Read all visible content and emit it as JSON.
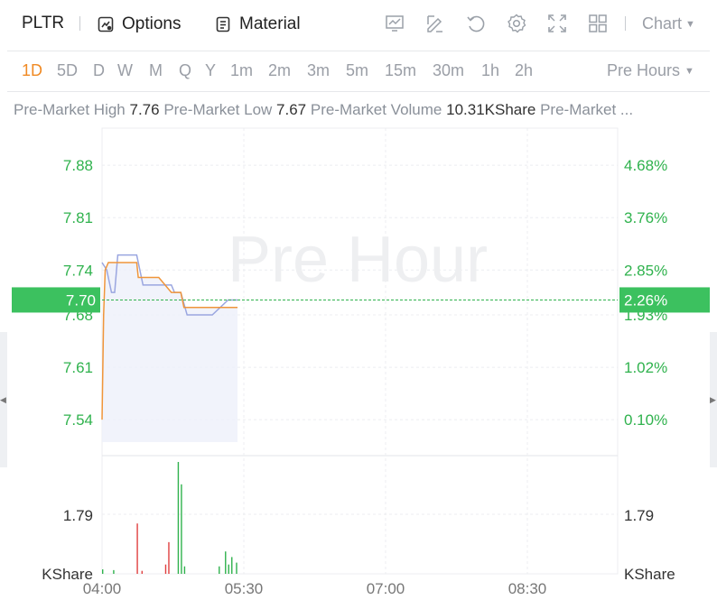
{
  "header": {
    "symbol": "PLTR",
    "options_label": "Options",
    "material_label": "Material",
    "chart_type_label": "Chart",
    "tools": [
      "chart-indicator-icon",
      "draw-icon",
      "reset-icon",
      "settings-icon",
      "fullscreen-icon",
      "layout-grid-icon"
    ]
  },
  "periods": {
    "items": [
      "1D",
      "5D",
      "D",
      "W",
      "M",
      "Q",
      "Y",
      "1m",
      "2m",
      "3m",
      "5m",
      "15m",
      "30m",
      "1h",
      "2h"
    ],
    "active": "1D",
    "hours_select": "Pre Hours"
  },
  "stats": {
    "high_label": "Pre-Market High",
    "high_value": "7.76",
    "low_label": "Pre-Market Low",
    "low_value": "7.67",
    "volume_label": "Pre-Market Volume",
    "volume_value": "10.31KShare",
    "more_label": "Pre-Market ..."
  },
  "chart_data": [
    {
      "type": "line",
      "watermark": "Pre Hour",
      "x_ticks": [
        "04:00",
        "05:30",
        "07:00",
        "08:30"
      ],
      "x_range_minutes": [
        0,
        270
      ],
      "ylim": [
        7.51,
        7.92
      ],
      "y_ticks": [
        "7.88",
        "7.81",
        "7.74",
        "7.68",
        "7.61",
        "7.54"
      ],
      "y_ticks_pct": [
        "4.68%",
        "3.76%",
        "2.85%",
        "1.93%",
        "1.02%",
        "0.10%"
      ],
      "current_price": "7.70",
      "current_pct": "2.26%",
      "colors": {
        "price": "#f0953a",
        "average": "#9aa6e0",
        "up": "#2fb24d",
        "down": "#e04040"
      },
      "series": [
        {
          "x": [
            0,
            1,
            2,
            4,
            7,
            9,
            10,
            13,
            22,
            23,
            27,
            30,
            36,
            44,
            50,
            52,
            54,
            58,
            65,
            72,
            80,
            86
          ],
          "values": [
            7.54,
            7.68,
            7.74,
            7.75,
            7.75,
            7.75,
            7.75,
            7.75,
            7.75,
            7.73,
            7.73,
            7.73,
            7.73,
            7.71,
            7.71,
            7.69,
            7.69,
            7.69,
            7.69,
            7.69,
            7.69,
            7.69
          ]
        },
        {
          "x": [
            0,
            3,
            6,
            8,
            10,
            16,
            22,
            26,
            30,
            36,
            40,
            44,
            46,
            50,
            54,
            60,
            70,
            80,
            86
          ],
          "values": [
            7.75,
            7.74,
            7.71,
            7.71,
            7.76,
            7.76,
            7.76,
            7.72,
            7.72,
            7.72,
            7.72,
            7.72,
            7.71,
            7.71,
            7.68,
            7.68,
            7.68,
            7.7,
            7.7
          ]
        }
      ]
    },
    {
      "type": "bar",
      "label_left": "1.79",
      "label_right": "1.79",
      "unit_left": "KShare",
      "unit_right": "KShare",
      "ylim": [
        0,
        3.0
      ],
      "bars": [
        {
          "x": 0,
          "value": 0.12,
          "dir": "up"
        },
        {
          "x": 7,
          "value": 0.1,
          "dir": "up"
        },
        {
          "x": 22,
          "value": 1.35,
          "dir": "down"
        },
        {
          "x": 25,
          "value": 0.08,
          "dir": "down"
        },
        {
          "x": 40,
          "value": 0.25,
          "dir": "down"
        },
        {
          "x": 42,
          "value": 0.85,
          "dir": "down"
        },
        {
          "x": 48,
          "value": 3.0,
          "dir": "up"
        },
        {
          "x": 50,
          "value": 2.4,
          "dir": "up"
        },
        {
          "x": 52,
          "value": 0.2,
          "dir": "up"
        },
        {
          "x": 74,
          "value": 0.2,
          "dir": "up"
        },
        {
          "x": 78,
          "value": 0.6,
          "dir": "up"
        },
        {
          "x": 80,
          "value": 0.25,
          "dir": "up"
        },
        {
          "x": 82,
          "value": 0.45,
          "dir": "up"
        },
        {
          "x": 85,
          "value": 0.3,
          "dir": "up"
        }
      ]
    }
  ]
}
